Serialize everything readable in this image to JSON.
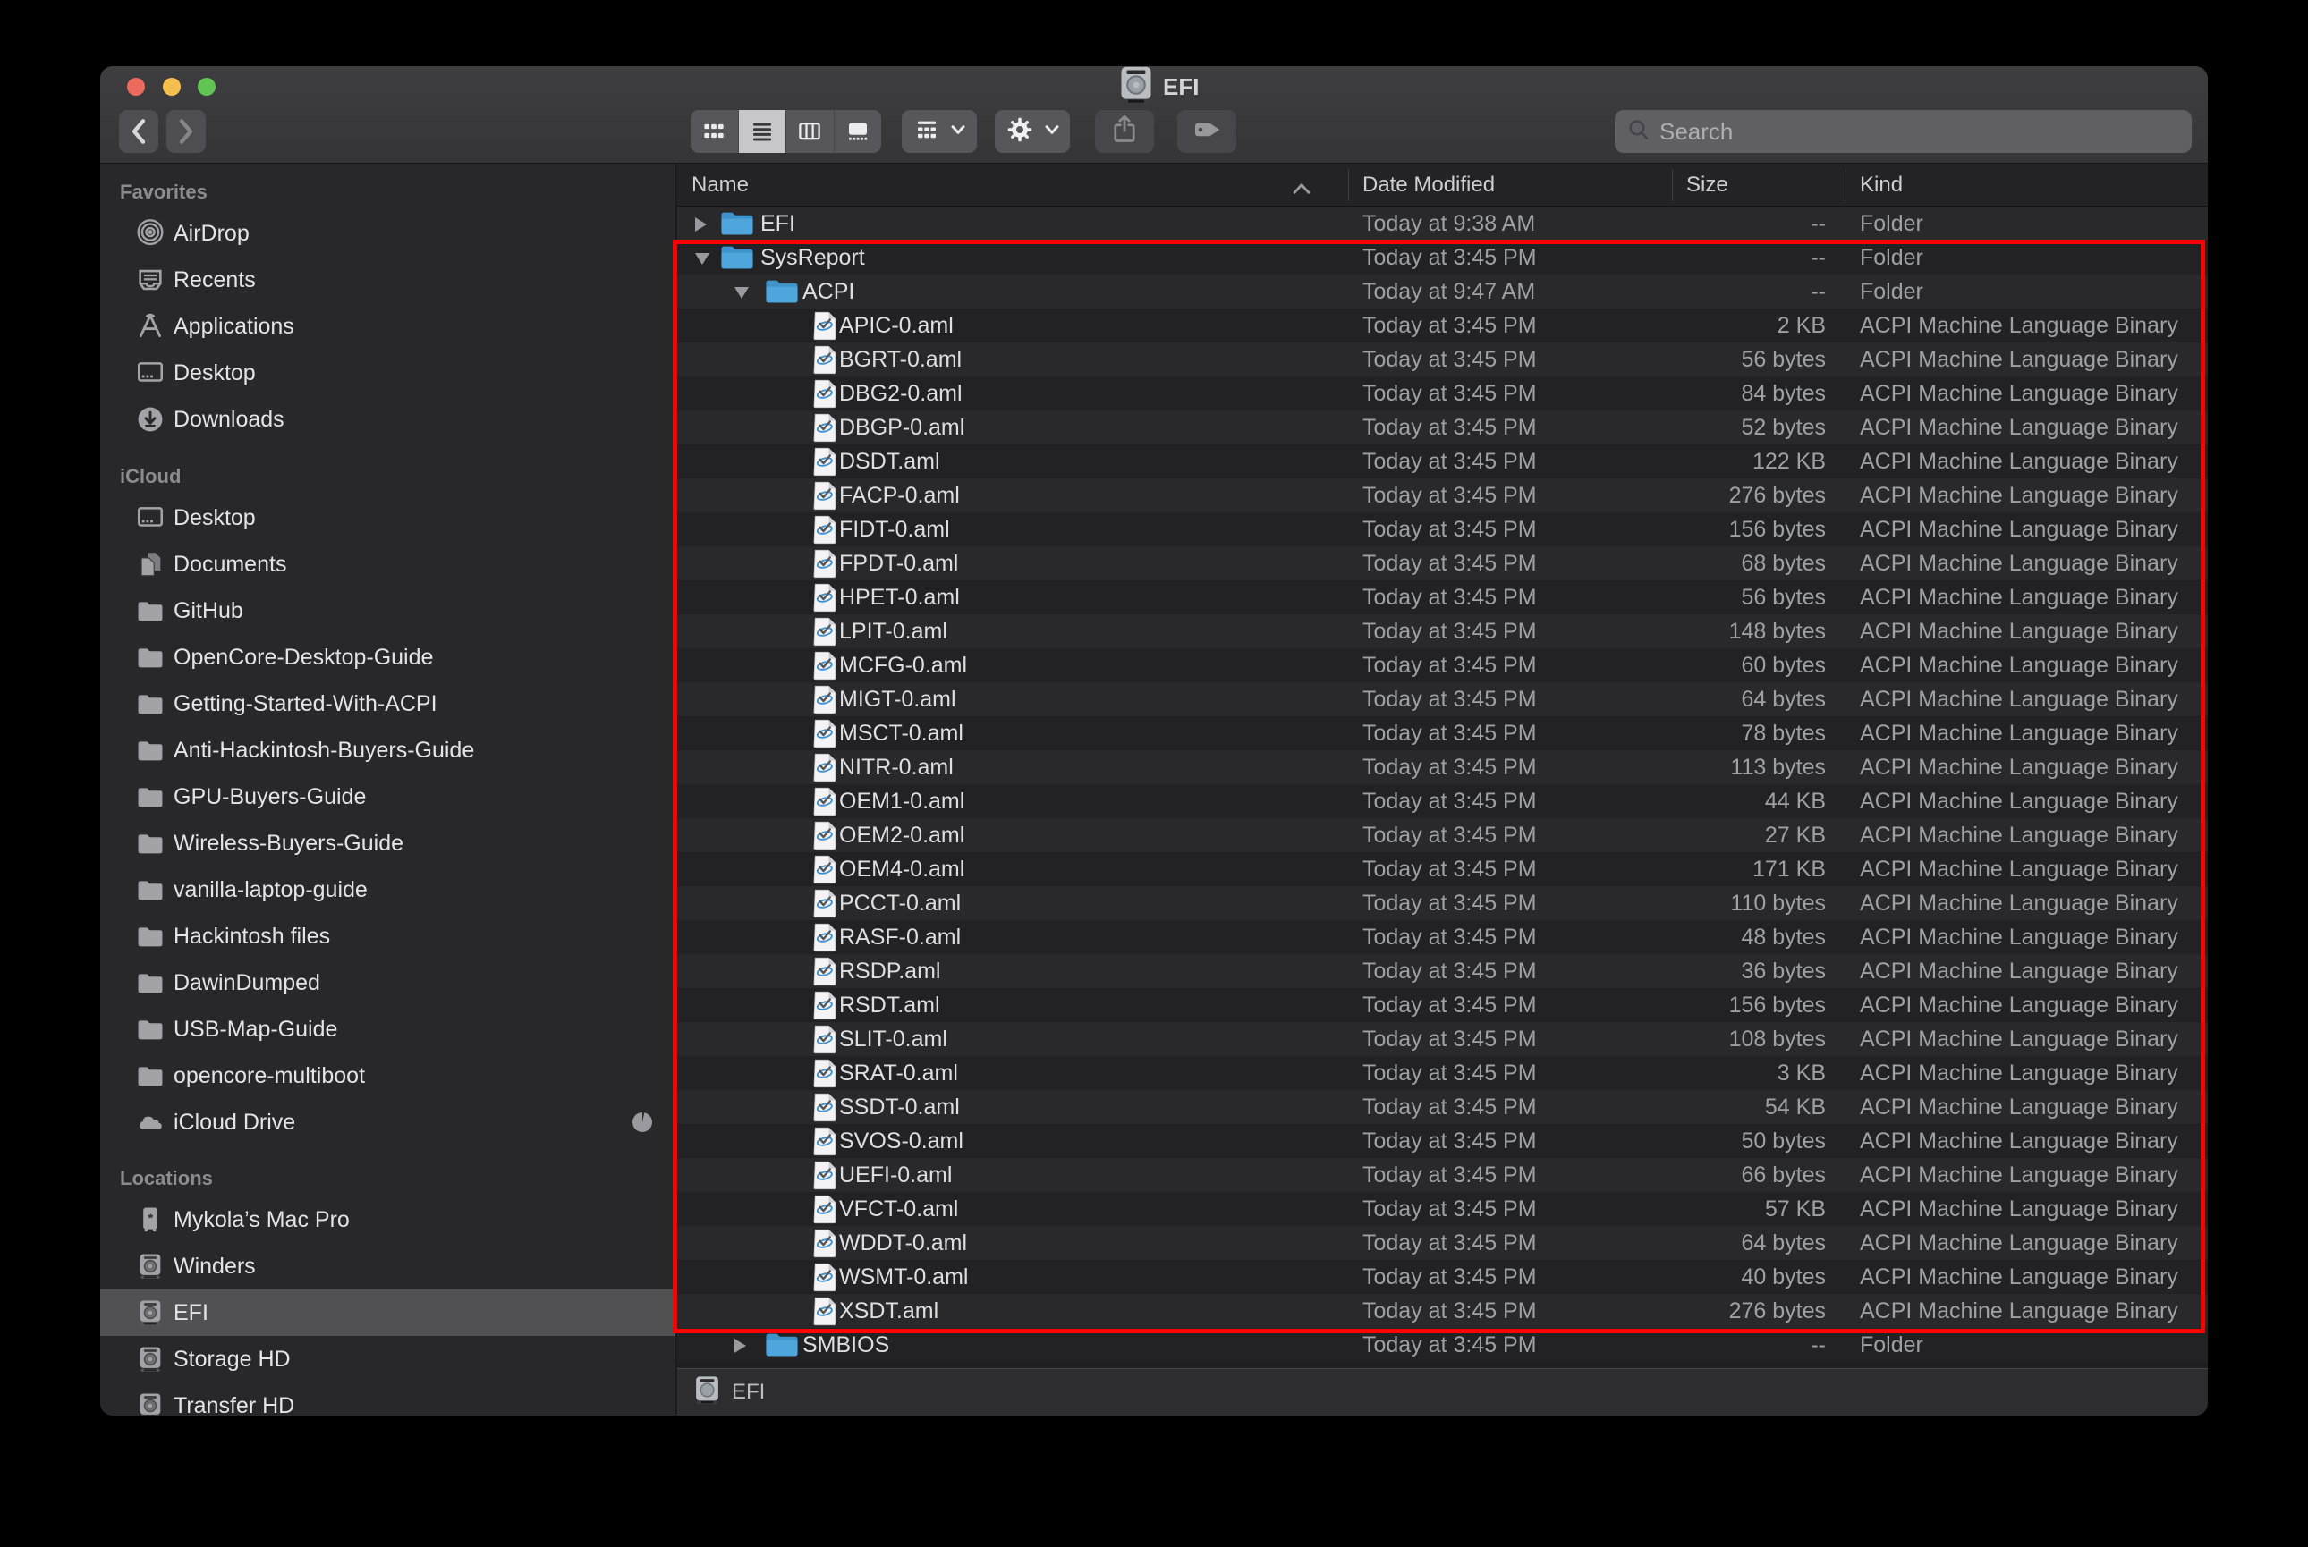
{
  "window": {
    "title": "EFI",
    "controls": [
      "close",
      "minimize",
      "zoom"
    ]
  },
  "toolbar": {
    "icons": [
      "back",
      "forward",
      "icon-view",
      "list-view",
      "column-view",
      "gallery-view",
      "group",
      "action",
      "share",
      "tag"
    ],
    "selected_view": "list-view",
    "search_placeholder": "Search"
  },
  "sidebar": {
    "sections": [
      {
        "label": "Favorites",
        "items": [
          {
            "label": "AirDrop",
            "icon": "airdrop"
          },
          {
            "label": "Recents",
            "icon": "recents"
          },
          {
            "label": "Applications",
            "icon": "applications"
          },
          {
            "label": "Desktop",
            "icon": "desktop"
          },
          {
            "label": "Downloads",
            "icon": "downloads"
          }
        ]
      },
      {
        "label": "iCloud",
        "items": [
          {
            "label": "Desktop",
            "icon": "desktop"
          },
          {
            "label": "Documents",
            "icon": "documents"
          },
          {
            "label": "GitHub",
            "icon": "folder"
          },
          {
            "label": "OpenCore-Desktop-Guide",
            "icon": "folder"
          },
          {
            "label": "Getting-Started-With-ACPI",
            "icon": "folder"
          },
          {
            "label": "Anti-Hackintosh-Buyers-Guide",
            "icon": "folder"
          },
          {
            "label": "GPU-Buyers-Guide",
            "icon": "folder"
          },
          {
            "label": "Wireless-Buyers-Guide",
            "icon": "folder"
          },
          {
            "label": "vanilla-laptop-guide",
            "icon": "folder"
          },
          {
            "label": "Hackintosh files",
            "icon": "folder"
          },
          {
            "label": "DawinDumped",
            "icon": "folder"
          },
          {
            "label": "USB-Map-Guide",
            "icon": "folder"
          },
          {
            "label": "opencore-multiboot",
            "icon": "folder"
          },
          {
            "label": "iCloud Drive",
            "icon": "cloud",
            "badge": "sync-pie"
          }
        ]
      },
      {
        "label": "Locations",
        "items": [
          {
            "label": "Mykola’s Mac Pro",
            "icon": "mac-pro"
          },
          {
            "label": "Winders",
            "icon": "drive"
          },
          {
            "label": "EFI",
            "icon": "drive",
            "selected": true
          },
          {
            "label": "Storage HD",
            "icon": "drive"
          },
          {
            "label": "Transfer HD",
            "icon": "drive"
          }
        ]
      }
    ]
  },
  "list": {
    "columns": [
      "Name",
      "Date Modified",
      "Size",
      "Kind"
    ],
    "sort_column": "Name",
    "sort_direction": "ascending",
    "rows": [
      {
        "name": "EFI",
        "indent": 0,
        "icon": "folder",
        "disclosure": "right",
        "date": "Today at 9:38 AM",
        "size": "--",
        "kind": "Folder"
      },
      {
        "name": "SysReport",
        "indent": 0,
        "icon": "folder",
        "disclosure": "down",
        "date": "Today at 3:45 PM",
        "size": "--",
        "kind": "Folder"
      },
      {
        "name": "ACPI",
        "indent": 1,
        "icon": "folder",
        "disclosure": "down",
        "date": "Today at 9:47 AM",
        "size": "--",
        "kind": "Folder"
      },
      {
        "name": "APIC-0.aml",
        "indent": 2,
        "icon": "aml-doc",
        "date": "Today at 3:45 PM",
        "size": "2 KB",
        "kind": "ACPI Machine Language Binary"
      },
      {
        "name": "BGRT-0.aml",
        "indent": 2,
        "icon": "aml-doc",
        "date": "Today at 3:45 PM",
        "size": "56 bytes",
        "kind": "ACPI Machine Language Binary"
      },
      {
        "name": "DBG2-0.aml",
        "indent": 2,
        "icon": "aml-doc",
        "date": "Today at 3:45 PM",
        "size": "84 bytes",
        "kind": "ACPI Machine Language Binary"
      },
      {
        "name": "DBGP-0.aml",
        "indent": 2,
        "icon": "aml-doc",
        "date": "Today at 3:45 PM",
        "size": "52 bytes",
        "kind": "ACPI Machine Language Binary"
      },
      {
        "name": "DSDT.aml",
        "indent": 2,
        "icon": "aml-doc",
        "date": "Today at 3:45 PM",
        "size": "122 KB",
        "kind": "ACPI Machine Language Binary"
      },
      {
        "name": "FACP-0.aml",
        "indent": 2,
        "icon": "aml-doc",
        "date": "Today at 3:45 PM",
        "size": "276 bytes",
        "kind": "ACPI Machine Language Binary"
      },
      {
        "name": "FIDT-0.aml",
        "indent": 2,
        "icon": "aml-doc",
        "date": "Today at 3:45 PM",
        "size": "156 bytes",
        "kind": "ACPI Machine Language Binary"
      },
      {
        "name": "FPDT-0.aml",
        "indent": 2,
        "icon": "aml-doc",
        "date": "Today at 3:45 PM",
        "size": "68 bytes",
        "kind": "ACPI Machine Language Binary"
      },
      {
        "name": "HPET-0.aml",
        "indent": 2,
        "icon": "aml-doc",
        "date": "Today at 3:45 PM",
        "size": "56 bytes",
        "kind": "ACPI Machine Language Binary"
      },
      {
        "name": "LPIT-0.aml",
        "indent": 2,
        "icon": "aml-doc",
        "date": "Today at 3:45 PM",
        "size": "148 bytes",
        "kind": "ACPI Machine Language Binary"
      },
      {
        "name": "MCFG-0.aml",
        "indent": 2,
        "icon": "aml-doc",
        "date": "Today at 3:45 PM",
        "size": "60 bytes",
        "kind": "ACPI Machine Language Binary"
      },
      {
        "name": "MIGT-0.aml",
        "indent": 2,
        "icon": "aml-doc",
        "date": "Today at 3:45 PM",
        "size": "64 bytes",
        "kind": "ACPI Machine Language Binary"
      },
      {
        "name": "MSCT-0.aml",
        "indent": 2,
        "icon": "aml-doc",
        "date": "Today at 3:45 PM",
        "size": "78 bytes",
        "kind": "ACPI Machine Language Binary"
      },
      {
        "name": "NITR-0.aml",
        "indent": 2,
        "icon": "aml-doc",
        "date": "Today at 3:45 PM",
        "size": "113 bytes",
        "kind": "ACPI Machine Language Binary"
      },
      {
        "name": "OEM1-0.aml",
        "indent": 2,
        "icon": "aml-doc",
        "date": "Today at 3:45 PM",
        "size": "44 KB",
        "kind": "ACPI Machine Language Binary"
      },
      {
        "name": "OEM2-0.aml",
        "indent": 2,
        "icon": "aml-doc",
        "date": "Today at 3:45 PM",
        "size": "27 KB",
        "kind": "ACPI Machine Language Binary"
      },
      {
        "name": "OEM4-0.aml",
        "indent": 2,
        "icon": "aml-doc",
        "date": "Today at 3:45 PM",
        "size": "171 KB",
        "kind": "ACPI Machine Language Binary"
      },
      {
        "name": "PCCT-0.aml",
        "indent": 2,
        "icon": "aml-doc",
        "date": "Today at 3:45 PM",
        "size": "110 bytes",
        "kind": "ACPI Machine Language Binary"
      },
      {
        "name": "RASF-0.aml",
        "indent": 2,
        "icon": "aml-doc",
        "date": "Today at 3:45 PM",
        "size": "48 bytes",
        "kind": "ACPI Machine Language Binary"
      },
      {
        "name": "RSDP.aml",
        "indent": 2,
        "icon": "aml-doc",
        "date": "Today at 3:45 PM",
        "size": "36 bytes",
        "kind": "ACPI Machine Language Binary"
      },
      {
        "name": "RSDT.aml",
        "indent": 2,
        "icon": "aml-doc",
        "date": "Today at 3:45 PM",
        "size": "156 bytes",
        "kind": "ACPI Machine Language Binary"
      },
      {
        "name": "SLIT-0.aml",
        "indent": 2,
        "icon": "aml-doc",
        "date": "Today at 3:45 PM",
        "size": "108 bytes",
        "kind": "ACPI Machine Language Binary"
      },
      {
        "name": "SRAT-0.aml",
        "indent": 2,
        "icon": "aml-doc",
        "date": "Today at 3:45 PM",
        "size": "3 KB",
        "kind": "ACPI Machine Language Binary"
      },
      {
        "name": "SSDT-0.aml",
        "indent": 2,
        "icon": "aml-doc",
        "date": "Today at 3:45 PM",
        "size": "54 KB",
        "kind": "ACPI Machine Language Binary"
      },
      {
        "name": "SVOS-0.aml",
        "indent": 2,
        "icon": "aml-doc",
        "date": "Today at 3:45 PM",
        "size": "50 bytes",
        "kind": "ACPI Machine Language Binary"
      },
      {
        "name": "UEFI-0.aml",
        "indent": 2,
        "icon": "aml-doc",
        "date": "Today at 3:45 PM",
        "size": "66 bytes",
        "kind": "ACPI Machine Language Binary"
      },
      {
        "name": "VFCT-0.aml",
        "indent": 2,
        "icon": "aml-doc",
        "date": "Today at 3:45 PM",
        "size": "57 KB",
        "kind": "ACPI Machine Language Binary"
      },
      {
        "name": "WDDT-0.aml",
        "indent": 2,
        "icon": "aml-doc",
        "date": "Today at 3:45 PM",
        "size": "64 bytes",
        "kind": "ACPI Machine Language Binary"
      },
      {
        "name": "WSMT-0.aml",
        "indent": 2,
        "icon": "aml-doc",
        "date": "Today at 3:45 PM",
        "size": "40 bytes",
        "kind": "ACPI Machine Language Binary"
      },
      {
        "name": "XSDT.aml",
        "indent": 2,
        "icon": "aml-doc",
        "date": "Today at 3:45 PM",
        "size": "276 bytes",
        "kind": "ACPI Machine Language Binary"
      },
      {
        "name": "SMBIOS",
        "indent": 1,
        "icon": "folder",
        "disclosure": "right",
        "date": "Today at 3:45 PM",
        "size": "--",
        "kind": "Folder"
      }
    ]
  },
  "pathbar": {
    "item": "EFI",
    "icon": "drive"
  },
  "annotation": {
    "shape": "rectangle",
    "color": "#ff0000"
  },
  "colors": {
    "traffic_close": "#ed6a5e",
    "traffic_min": "#f5bf4f",
    "traffic_zoom": "#61c554",
    "folder_blue": "#4aa0d6",
    "row_light": "#29292b",
    "row_dark": "#222224",
    "sidebar_selected": "#515154"
  }
}
